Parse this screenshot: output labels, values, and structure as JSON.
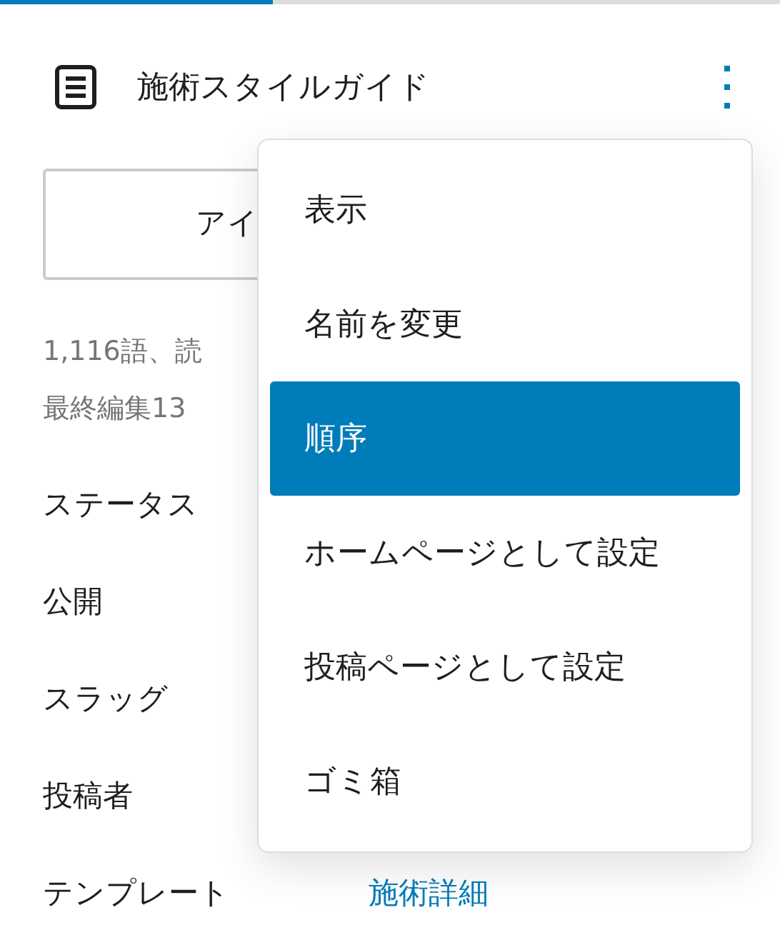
{
  "progress": {
    "level": 0.35
  },
  "header": {
    "title": "施術スタイルガイド"
  },
  "action_button": {
    "label": "アイ"
  },
  "meta": [
    "1,116語、読",
    "最終編集13"
  ],
  "fields": [
    {
      "label": "ステータス"
    },
    {
      "label": "公開"
    },
    {
      "label": "スラッグ"
    },
    {
      "label": "投稿者"
    },
    {
      "label": "テンプレート",
      "value": "施術詳細"
    }
  ],
  "menu": [
    {
      "label": "表示",
      "selected": false
    },
    {
      "label": "名前を変更",
      "selected": false
    },
    {
      "label": "順序",
      "selected": true
    },
    {
      "label": "ホームページとして設定",
      "selected": false
    },
    {
      "label": "投稿ページとして設定",
      "selected": false
    },
    {
      "label": "ゴミ箱",
      "selected": false
    }
  ]
}
